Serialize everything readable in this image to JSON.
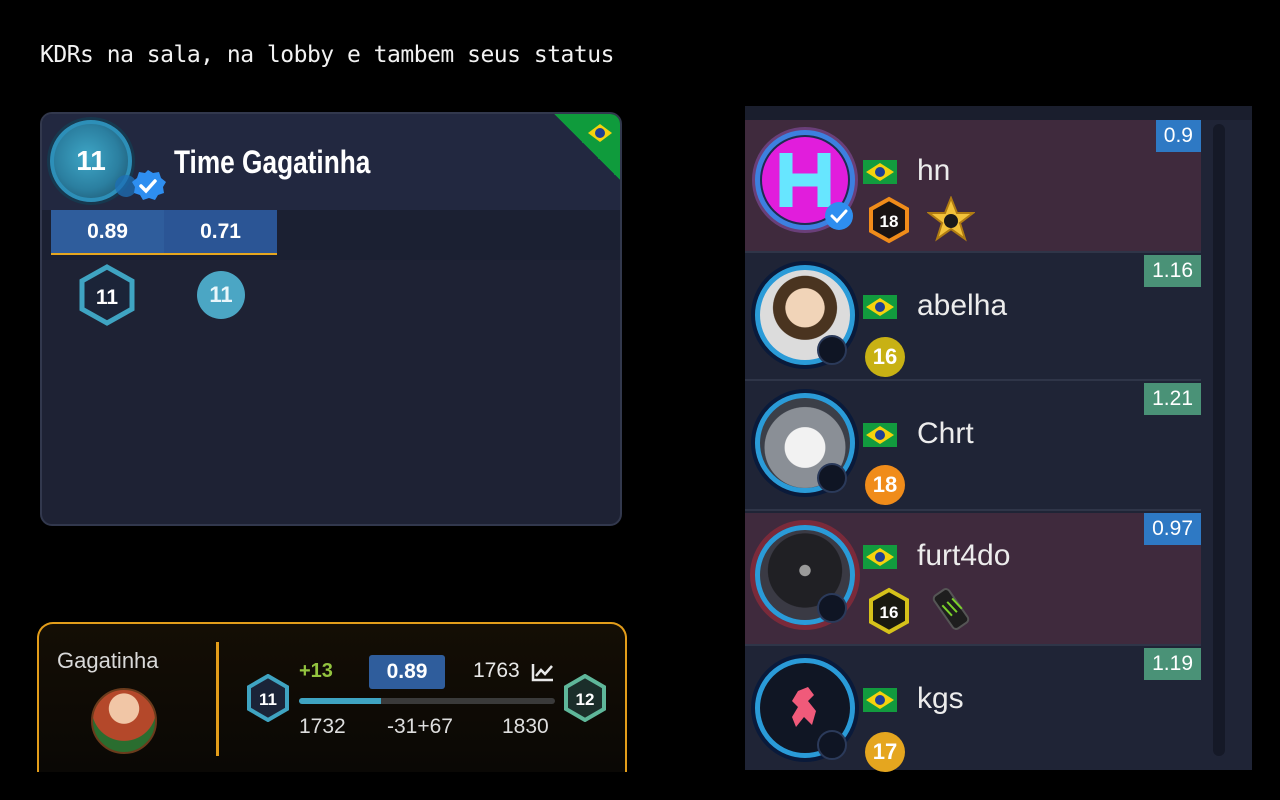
{
  "caption": "KDRs na sala, na lobby e tambem seus status",
  "team_card": {
    "level": "11",
    "name": "Time Gagatinha",
    "kdr_values": [
      "0.89",
      "0.71"
    ],
    "member_levels": [
      "11",
      "11"
    ],
    "country_flag_icon": "brazil-flag-icon"
  },
  "match_panel": {
    "player_name": "Gagatinha",
    "current_level": "11",
    "next_level": "12",
    "elo_gain": "+13",
    "kdr": "0.89",
    "elo": "1763",
    "elo_min": "1732",
    "elo_delta": "-31+67",
    "elo_max": "1830",
    "progress": 0.32,
    "accent_color": "#e39d1a"
  },
  "players": [
    {
      "name": "hn",
      "kdr": "0.9",
      "level": "18",
      "kdr_color": "blue",
      "highlight": true
    },
    {
      "name": "abelha",
      "kdr": "1.16",
      "level": "16",
      "kdr_color": "green",
      "highlight": false
    },
    {
      "name": "Chrt",
      "kdr": "1.21",
      "level": "18",
      "kdr_color": "green",
      "highlight": false
    },
    {
      "name": "furt4do",
      "kdr": "0.97",
      "level": "16",
      "kdr_color": "blue",
      "highlight": true
    },
    {
      "name": "kgs",
      "kdr": "1.19",
      "level": "17",
      "kdr_color": "green",
      "highlight": false
    }
  ]
}
